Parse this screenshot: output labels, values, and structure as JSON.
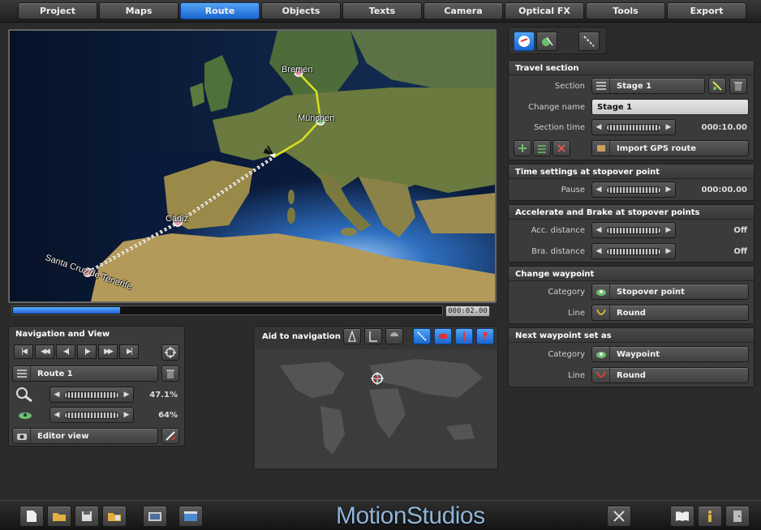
{
  "tabs": [
    {
      "label": "Project",
      "active": false
    },
    {
      "label": "Maps",
      "active": false
    },
    {
      "label": "Route",
      "active": true
    },
    {
      "label": "Objects",
      "active": false
    },
    {
      "label": "Texts",
      "active": false
    },
    {
      "label": "Camera",
      "active": false
    },
    {
      "label": "Optical FX",
      "active": false
    },
    {
      "label": "Tools",
      "active": false
    },
    {
      "label": "Export",
      "active": false
    }
  ],
  "map": {
    "labels": {
      "bremen": "Bremen",
      "munchen": "München",
      "cadiz": "Cádiz",
      "santa_cruz": "Santa Cruz de Tenerife"
    },
    "timecode": "000:02.00",
    "progress": 0.25
  },
  "navigation": {
    "title": "Navigation and View",
    "route_name": "Route 1",
    "zoom_value": "47.1%",
    "tilt_value": "64%",
    "view_mode": "Editor view"
  },
  "aid": {
    "title": "Aid to navigation"
  },
  "travel": {
    "title": "Travel section",
    "section_label": "Section",
    "section_value": "Stage 1",
    "change_name_label": "Change name",
    "change_name_value": "Stage 1",
    "section_time_label": "Section time",
    "section_time_value": "000:10.00",
    "import_label": "Import GPS route"
  },
  "time_settings": {
    "title": "Time settings at stopover point",
    "pause_label": "Pause",
    "pause_value": "000:00.00"
  },
  "accel": {
    "title": "Accelerate and Brake at stopover points",
    "acc_label": "Acc. distance",
    "acc_value": "Off",
    "bra_label": "Bra. distance",
    "bra_value": "Off"
  },
  "change_wp": {
    "title": "Change waypoint",
    "category_label": "Category",
    "category_value": "Stopover point",
    "line_label": "Line",
    "line_value": "Round"
  },
  "next_wp": {
    "title": "Next waypoint set as",
    "category_label": "Category",
    "category_value": "Waypoint",
    "line_label": "Line",
    "line_value": "Round"
  },
  "brand": "MotionStudios",
  "colors": {
    "accent_blue": "#2a7ee6",
    "route_yellow": "#d8e020",
    "panel_bg": "#3b3b3b"
  }
}
